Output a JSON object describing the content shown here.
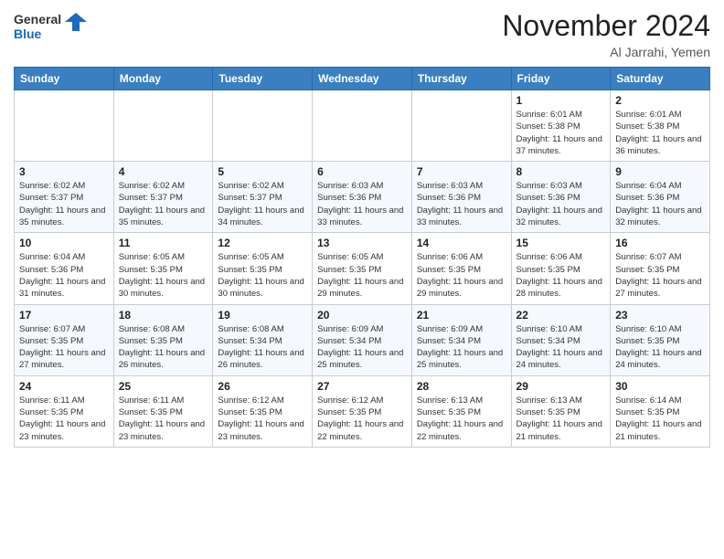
{
  "header": {
    "logo_general": "General",
    "logo_blue": "Blue",
    "month_title": "November 2024",
    "location": "Al Jarrahi, Yemen"
  },
  "weekdays": [
    "Sunday",
    "Monday",
    "Tuesday",
    "Wednesday",
    "Thursday",
    "Friday",
    "Saturday"
  ],
  "weeks": [
    [
      {
        "day": "",
        "info": ""
      },
      {
        "day": "",
        "info": ""
      },
      {
        "day": "",
        "info": ""
      },
      {
        "day": "",
        "info": ""
      },
      {
        "day": "",
        "info": ""
      },
      {
        "day": "1",
        "info": "Sunrise: 6:01 AM\nSunset: 5:38 PM\nDaylight: 11 hours\nand 37 minutes."
      },
      {
        "day": "2",
        "info": "Sunrise: 6:01 AM\nSunset: 5:38 PM\nDaylight: 11 hours\nand 36 minutes."
      }
    ],
    [
      {
        "day": "3",
        "info": "Sunrise: 6:02 AM\nSunset: 5:37 PM\nDaylight: 11 hours\nand 35 minutes."
      },
      {
        "day": "4",
        "info": "Sunrise: 6:02 AM\nSunset: 5:37 PM\nDaylight: 11 hours\nand 35 minutes."
      },
      {
        "day": "5",
        "info": "Sunrise: 6:02 AM\nSunset: 5:37 PM\nDaylight: 11 hours\nand 34 minutes."
      },
      {
        "day": "6",
        "info": "Sunrise: 6:03 AM\nSunset: 5:36 PM\nDaylight: 11 hours\nand 33 minutes."
      },
      {
        "day": "7",
        "info": "Sunrise: 6:03 AM\nSunset: 5:36 PM\nDaylight: 11 hours\nand 33 minutes."
      },
      {
        "day": "8",
        "info": "Sunrise: 6:03 AM\nSunset: 5:36 PM\nDaylight: 11 hours\nand 32 minutes."
      },
      {
        "day": "9",
        "info": "Sunrise: 6:04 AM\nSunset: 5:36 PM\nDaylight: 11 hours\nand 32 minutes."
      }
    ],
    [
      {
        "day": "10",
        "info": "Sunrise: 6:04 AM\nSunset: 5:36 PM\nDaylight: 11 hours\nand 31 minutes."
      },
      {
        "day": "11",
        "info": "Sunrise: 6:05 AM\nSunset: 5:35 PM\nDaylight: 11 hours\nand 30 minutes."
      },
      {
        "day": "12",
        "info": "Sunrise: 6:05 AM\nSunset: 5:35 PM\nDaylight: 11 hours\nand 30 minutes."
      },
      {
        "day": "13",
        "info": "Sunrise: 6:05 AM\nSunset: 5:35 PM\nDaylight: 11 hours\nand 29 minutes."
      },
      {
        "day": "14",
        "info": "Sunrise: 6:06 AM\nSunset: 5:35 PM\nDaylight: 11 hours\nand 29 minutes."
      },
      {
        "day": "15",
        "info": "Sunrise: 6:06 AM\nSunset: 5:35 PM\nDaylight: 11 hours\nand 28 minutes."
      },
      {
        "day": "16",
        "info": "Sunrise: 6:07 AM\nSunset: 5:35 PM\nDaylight: 11 hours\nand 27 minutes."
      }
    ],
    [
      {
        "day": "17",
        "info": "Sunrise: 6:07 AM\nSunset: 5:35 PM\nDaylight: 11 hours\nand 27 minutes."
      },
      {
        "day": "18",
        "info": "Sunrise: 6:08 AM\nSunset: 5:35 PM\nDaylight: 11 hours\nand 26 minutes."
      },
      {
        "day": "19",
        "info": "Sunrise: 6:08 AM\nSunset: 5:34 PM\nDaylight: 11 hours\nand 26 minutes."
      },
      {
        "day": "20",
        "info": "Sunrise: 6:09 AM\nSunset: 5:34 PM\nDaylight: 11 hours\nand 25 minutes."
      },
      {
        "day": "21",
        "info": "Sunrise: 6:09 AM\nSunset: 5:34 PM\nDaylight: 11 hours\nand 25 minutes."
      },
      {
        "day": "22",
        "info": "Sunrise: 6:10 AM\nSunset: 5:34 PM\nDaylight: 11 hours\nand 24 minutes."
      },
      {
        "day": "23",
        "info": "Sunrise: 6:10 AM\nSunset: 5:35 PM\nDaylight: 11 hours\nand 24 minutes."
      }
    ],
    [
      {
        "day": "24",
        "info": "Sunrise: 6:11 AM\nSunset: 5:35 PM\nDaylight: 11 hours\nand 23 minutes."
      },
      {
        "day": "25",
        "info": "Sunrise: 6:11 AM\nSunset: 5:35 PM\nDaylight: 11 hours\nand 23 minutes."
      },
      {
        "day": "26",
        "info": "Sunrise: 6:12 AM\nSunset: 5:35 PM\nDaylight: 11 hours\nand 23 minutes."
      },
      {
        "day": "27",
        "info": "Sunrise: 6:12 AM\nSunset: 5:35 PM\nDaylight: 11 hours\nand 22 minutes."
      },
      {
        "day": "28",
        "info": "Sunrise: 6:13 AM\nSunset: 5:35 PM\nDaylight: 11 hours\nand 22 minutes."
      },
      {
        "day": "29",
        "info": "Sunrise: 6:13 AM\nSunset: 5:35 PM\nDaylight: 11 hours\nand 21 minutes."
      },
      {
        "day": "30",
        "info": "Sunrise: 6:14 AM\nSunset: 5:35 PM\nDaylight: 11 hours\nand 21 minutes."
      }
    ]
  ]
}
